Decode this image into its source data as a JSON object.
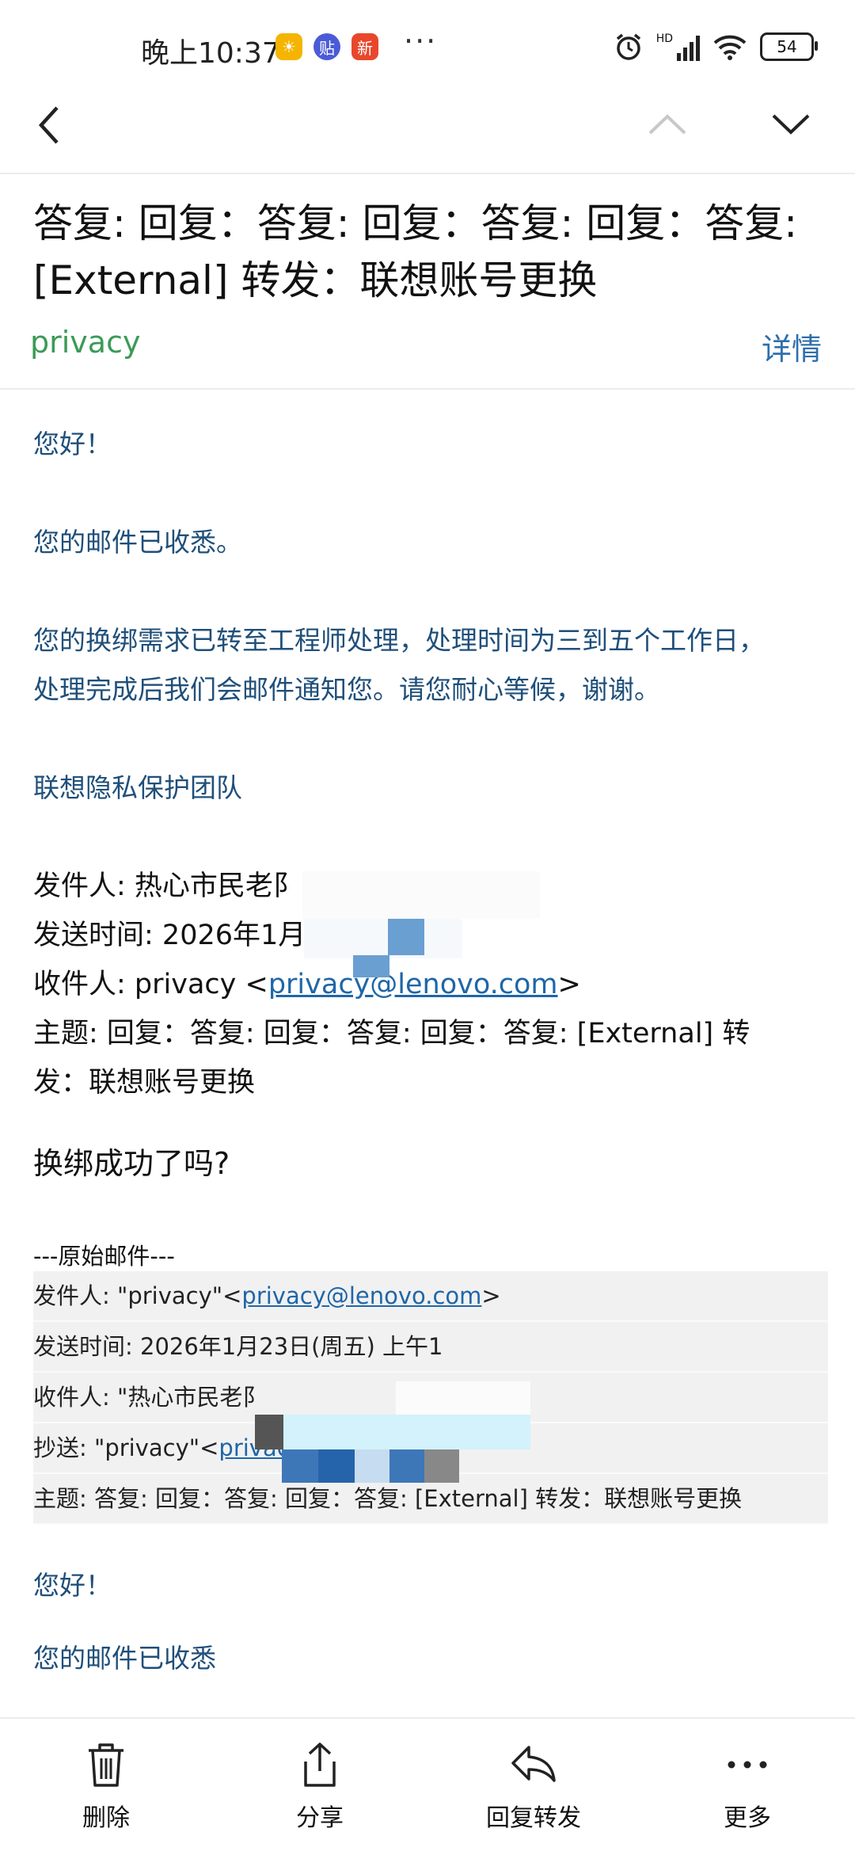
{
  "status_bar": {
    "time": "晚上10:37",
    "app_icons": [
      "weather-icon",
      "tieba-icon",
      "news-icon"
    ],
    "app_icon_labels": [
      "",
      "贴",
      "新"
    ],
    "more": "···",
    "network": "HD",
    "battery": "54"
  },
  "nav": {
    "back": "back-arrow-icon",
    "prev": "chevron-up-icon",
    "next": "chevron-down-icon"
  },
  "header": {
    "subject_line1": "答复: 回复：答复: 回复：答复: 回复：答复:",
    "subject_line2": "[External] 转发：联想账号更换",
    "sender": "privacy",
    "details_link": "详情"
  },
  "reply": {
    "greeting": "您好！",
    "received": "您的邮件已收悉。",
    "processing_1": "您的换绑需求已转至工程师处理，处理时间为三到五个工作日，",
    "processing_2": "处理完成后我们会邮件通知您。请您耐心等候，谢谢。",
    "signature": "联想隐私保护团队"
  },
  "quoted": {
    "from_label": "发件人: ",
    "from_value": "热心市民老阝",
    "sent_label": "发送时间: ",
    "sent_value": "2026年1月",
    "to_label": "收件人: ",
    "to_name": "privacy <",
    "to_email": "privacy@lenovo.com",
    "to_close": ">",
    "subject_line1": "主题: 回复：答复: 回复：答复: 回复：答复: [External] 转",
    "subject_line2": "发：联想账号更换"
  },
  "question": "换绑成功了吗?",
  "original": {
    "header": "---原始邮件---",
    "from_prefix": "发件人: \"privacy\"<",
    "from_email": "privacy@lenovo.com",
    "from_suffix": ">",
    "sent": "发送时间: 2026年1月23日(周五) 上午1",
    "to": "收件人: \"热心市民老阝",
    "cc_prefix": "抄送: \"privacy\"<",
    "cc_email": "privac",
    "subject": "主题: 答复: 回复：答复: 回复：答复: [External] 转发：联想账号更换"
  },
  "trailing": {
    "greeting": "您好！",
    "partial": "您的邮件已收悉"
  },
  "bottom_bar": {
    "delete": "删除",
    "share": "分享",
    "reply_forward": "回复转发",
    "more": "更多"
  },
  "colors": {
    "sender_green": "#3a9b56",
    "link_blue": "#1f66a8",
    "body_blue": "#1f4f7a"
  }
}
